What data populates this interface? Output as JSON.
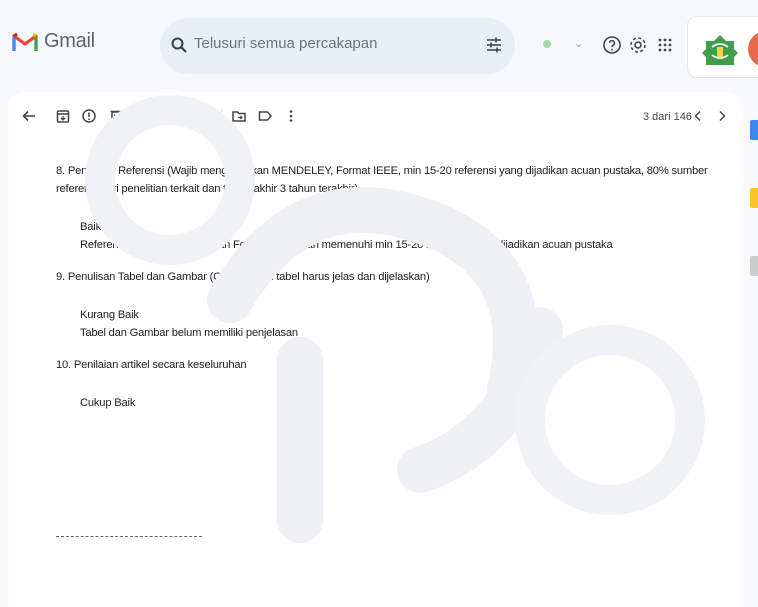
{
  "header": {
    "app_name": "Gmail",
    "search": {
      "placeholder": "Telusuri semua percakapan"
    },
    "icons": [
      "gmail-logo-icon",
      "search-icon",
      "tune-icon",
      "help-icon",
      "settings-icon",
      "apps-grid-icon"
    ]
  },
  "toolbar": {
    "pager_text": "3 dari 146",
    "icons": [
      "back-icon",
      "archive-icon",
      "report-spam-icon",
      "delete-icon",
      "mark-unread-icon",
      "snooze-icon",
      "add-task-icon",
      "move-to-icon",
      "label-icon",
      "more-icon",
      "prev-icon",
      "next-icon"
    ]
  },
  "message": {
    "item8_question": "8. Penulisan Referensi (Wajib menggunakan MENDELEY, Format IEEE, min 15-20 referensi yang dijadikan acuan pustaka, 80% sumber referensi dari penelitian terkait dan termutakhir 3 tahun terakhir)",
    "item8_rating": "Baik",
    "item8_comment": "Referensi sudah menggunakan Format IEEE, dan memenuhi min 15-20 referensi yang dijadikan acuan pustaka",
    "item9_question": "9. Penulisan Tabel dan Gambar (Gambar dan tabel harus jelas dan dijelaskan)",
    "item9_rating": "Kurang Baik",
    "item9_comment": "Tabel dan Gambar belum memiliki penjelasan",
    "item10_question": "10. Penilaian artikel secara keseluruhan",
    "item10_rating": "Cukup Baik"
  },
  "colors": {
    "background": "#f6f8fc",
    "search_bg": "#e9eef6",
    "panel": "#ffffff",
    "gmail_red": "#ea4335"
  }
}
